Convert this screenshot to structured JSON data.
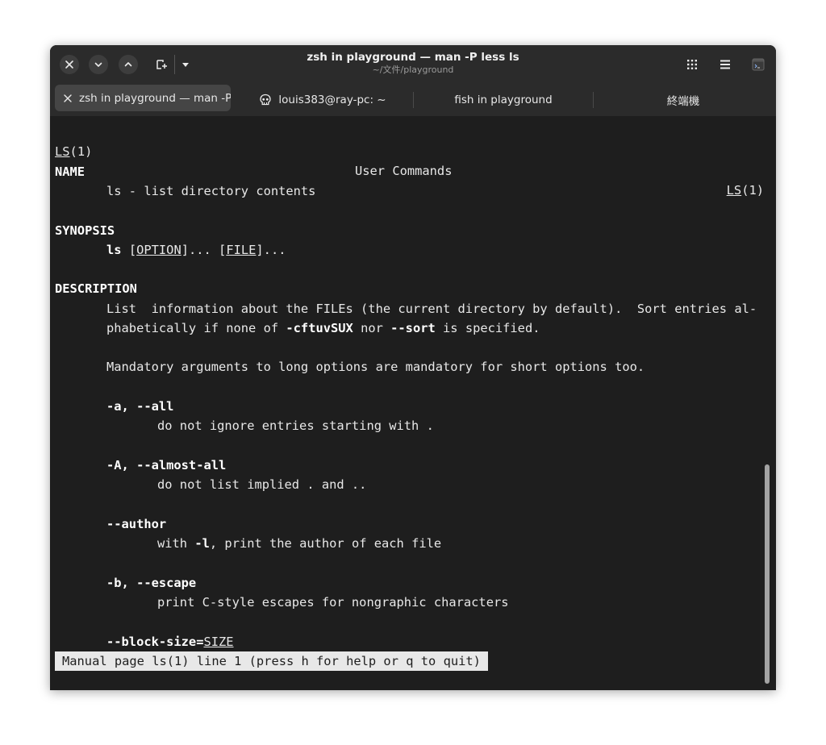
{
  "window": {
    "title": "zsh in playground — man -P less ls",
    "subtitle": "~/文件/playground"
  },
  "header_buttons": [
    {
      "name": "close-button",
      "icon": "close-icon"
    },
    {
      "name": "scroll-down-button",
      "icon": "chevron-down-icon"
    },
    {
      "name": "scroll-up-button",
      "icon": "chevron-up-icon"
    },
    {
      "name": "new-tab-button",
      "icon": "new-tab-icon"
    },
    {
      "name": "tab-menu-button",
      "icon": "caret-down-icon"
    },
    {
      "name": "tab-overview-button",
      "icon": "grid-icon"
    },
    {
      "name": "main-menu-button",
      "icon": "hamburger-icon"
    },
    {
      "name": "terminal-app-icon",
      "icon": "terminal-icon"
    }
  ],
  "tabs": [
    {
      "label": "zsh in playground — man -P less ls",
      "active": true
    },
    {
      "label": "louis383@ray-pc: ~",
      "icon": "skull-icon"
    },
    {
      "label": "fish in playground"
    },
    {
      "label": "終端機"
    }
  ],
  "man": {
    "header_left_name": "LS",
    "header_left_section": "(1)",
    "header_center": "User Commands",
    "header_right_name": "LS",
    "header_right_section": "(1)",
    "name_heading": "NAME",
    "name_text": "ls - list directory contents",
    "synopsis_heading": "SYNOPSIS",
    "synopsis_cmd": "ls",
    "synopsis_open1": "[",
    "synopsis_option": "OPTION",
    "synopsis_mid": "]... [",
    "synopsis_file": "FILE",
    "synopsis_end": "]...",
    "description_heading": "DESCRIPTION",
    "desc_line1": "List  information about the FILEs (the current directory by default).  Sort entries al‐",
    "desc_line2_a": "phabetically if none of ",
    "desc_line2_b": "-cftuvSUX",
    "desc_line2_c": " nor ",
    "desc_line2_d": "--sort",
    "desc_line2_e": " is specified.",
    "desc_para2": "Mandatory arguments to long options are mandatory for short options too.",
    "opt_all": "-a, --all",
    "opt_all_desc": "do not ignore entries starting with .",
    "opt_almost": "-A, --almost-all",
    "opt_almost_desc": "do not list implied . and ..",
    "opt_author": "--author",
    "opt_author_desc_a": "with ",
    "opt_author_desc_b": "-l",
    "opt_author_desc_c": ", print the author of each file",
    "opt_escape": "-b, --escape",
    "opt_escape_desc": "print C-style escapes for nongraphic characters",
    "opt_blocksize": "--block-size=",
    "opt_blocksize_arg": "SIZE",
    "status": "Manual page ls(1) line 1 (press h for help or q to quit)"
  }
}
